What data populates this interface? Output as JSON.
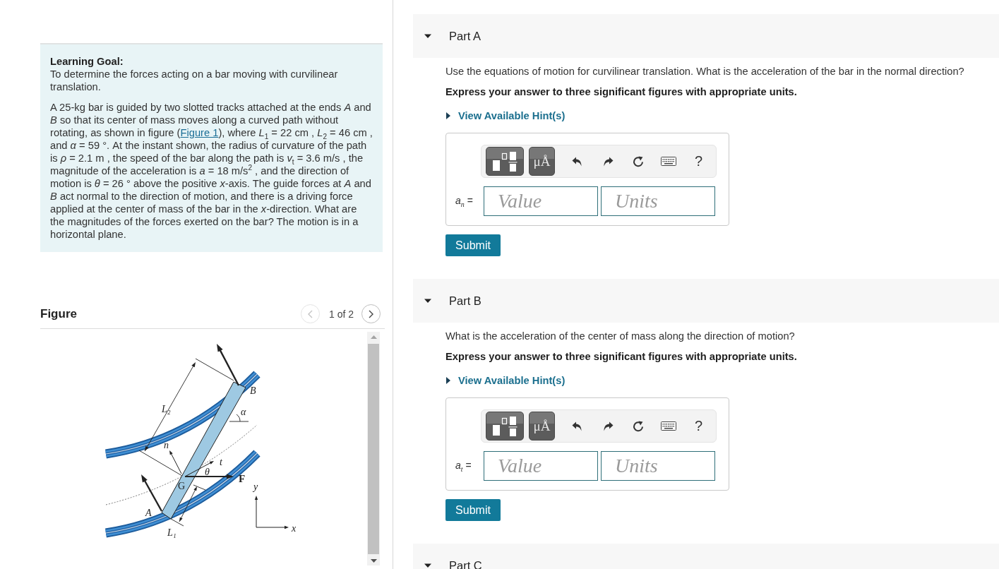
{
  "learning_goal": {
    "heading": "Learning Goal:",
    "goal": "To determine the forces acting on a bar moving with curvilinear translation.",
    "problem_before_link": "A 25-kg bar is guided by two slotted tracks attached at the ends *A* and *B* so that its center of mass moves along a curved path without rotating, as shown in figure (",
    "problem_link": "Figure 1",
    "problem_after_link": "), where *L*$_{1}$ = 22 cm , *L*$_{2}$ = 46 cm , and *α* = 59 °. At the instant shown, the radius of curvature of the path is *ρ* = 2.1 m , the speed of the bar along the path is *v*$_{t}$ = 3.6 m/s , the magnitude of the acceleration is *a* = 18 m/s$^{2}$ , and the direction of motion is *θ* = 26 ° above the positive *x*-axis. The guide forces at *A* and *B* act normal to the direction of motion, and there is a driving force applied at the center of mass of the bar in the *x*-direction. What are the magnitudes of the forces exerted on the bar? The motion is in a horizontal plane."
  },
  "figure": {
    "heading": "Figure",
    "pager": {
      "text": "1 of 2",
      "prev_disabled": true,
      "next_disabled": false
    },
    "labels": [
      {
        "text": "B",
        "kind": "symbol"
      },
      {
        "text": "L₂",
        "kind": "symbol"
      },
      {
        "text": "α",
        "kind": "symbol"
      },
      {
        "text": "n",
        "kind": "symbol"
      },
      {
        "text": "t",
        "kind": "symbol"
      },
      {
        "text": "θ",
        "kind": "symbol"
      },
      {
        "text": "F",
        "kind": "vector"
      },
      {
        "text": "G",
        "kind": "upright"
      },
      {
        "text": "y",
        "kind": "symbol"
      },
      {
        "text": "A",
        "kind": "symbol"
      },
      {
        "text": "x",
        "kind": "symbol"
      },
      {
        "text": "L₁",
        "kind": "symbol"
      }
    ]
  },
  "parts": [
    {
      "title": "Part A",
      "expanded": true,
      "question": "Use the equations of motion for curvilinear translation. What is the acceleration of the bar in the normal direction?",
      "instruction": "Express your answer to three significant figures with appropriate units.",
      "hint": {
        "label": "View Available Hint(s)",
        "expanded": false
      },
      "answer": {
        "units_button": "μÅ",
        "help": "?",
        "variable": "*a*$_{n}$ =",
        "value_placeholder": "Value",
        "units_placeholder": "Units"
      },
      "submit": "Submit"
    },
    {
      "title": "Part B",
      "expanded": true,
      "question": "What is the acceleration of the center of mass along the direction of motion?",
      "instruction": "Express your answer to three significant figures with appropriate units.",
      "hint": {
        "label": "View Available Hint(s)",
        "expanded": false
      },
      "answer": {
        "units_button": "μÅ",
        "help": "?",
        "variable": "*a*$_{t}$ =",
        "value_placeholder": "Value",
        "units_placeholder": "Units"
      },
      "submit": "Submit"
    },
    {
      "title": "Part C",
      "expanded": true
    }
  ]
}
